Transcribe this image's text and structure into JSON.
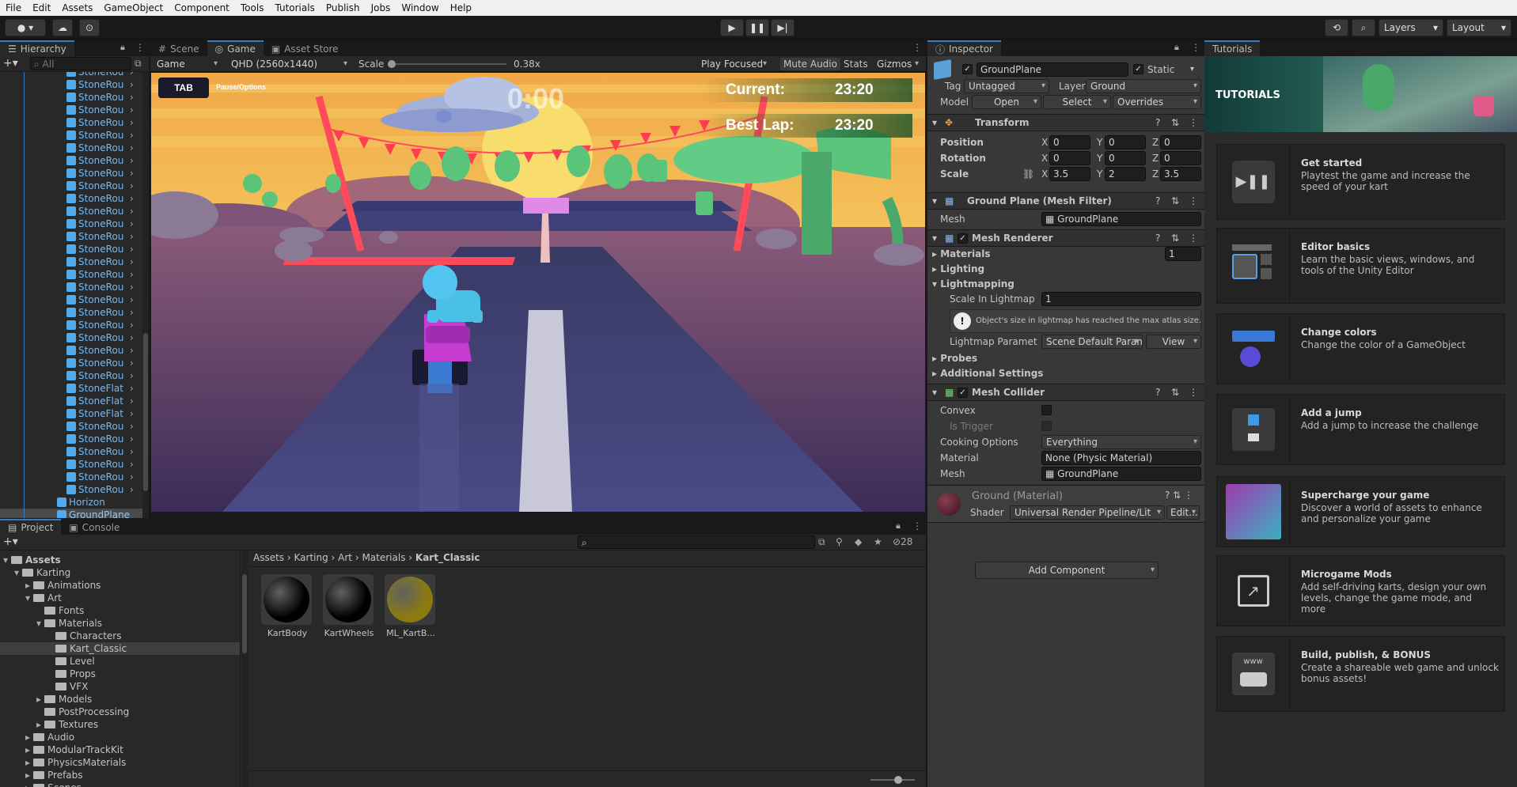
{
  "menu": [
    "File",
    "Edit",
    "Assets",
    "GameObject",
    "Component",
    "Tools",
    "Tutorials",
    "Publish",
    "Jobs",
    "Window",
    "Help"
  ],
  "toolbar": {
    "layers": "Layers",
    "layout": "Layout"
  },
  "hierarchy": {
    "tab": "Hierarchy",
    "search_placeholder": "All",
    "stone_items": [
      "StoneRou",
      "StoneRou",
      "StoneRou",
      "StoneRou",
      "StoneRou",
      "StoneRou",
      "StoneRou",
      "StoneRou",
      "StoneRou",
      "StoneRou",
      "StoneRou",
      "StoneRou",
      "StoneRou",
      "StoneRou",
      "StoneRou",
      "StoneRou",
      "StoneRou",
      "StoneRou",
      "StoneRou",
      "StoneRou",
      "StoneRou",
      "StoneRou",
      "StoneRou",
      "StoneRou",
      "StoneRou",
      "StoneFlat",
      "StoneFlat",
      "StoneFlat",
      "StoneRou",
      "StoneRou",
      "StoneRou",
      "StoneRou",
      "StoneRou",
      "StoneRou"
    ],
    "horizon": "Horizon",
    "groundplane": "GroundPlane"
  },
  "game": {
    "tabs": [
      "Scene",
      "Game",
      "Asset Store"
    ],
    "display": "Game",
    "resolution": "QHD (2560x1440)",
    "scale_label": "Scale",
    "scale_value": "0.38x",
    "play_focused": "Play Focused",
    "mute": "Mute Audio",
    "stats": "Stats",
    "gizmos": "Gizmos",
    "hud_tab": "TAB",
    "hud_pause": "Pause/Options",
    "hud_timer": "0:00",
    "hud_current_label": "Current:",
    "hud_current_value": "23:20",
    "hud_best_label": "Best Lap:",
    "hud_best_value": "23:20"
  },
  "inspector": {
    "tab": "Inspector",
    "object_name": "GroundPlane",
    "static": "Static",
    "tag_label": "Tag",
    "tag": "Untagged",
    "layer_label": "Layer",
    "layer": "Ground",
    "model_label": "Model",
    "open": "Open",
    "select": "Select",
    "overrides": "Overrides",
    "transform": {
      "title": "Transform",
      "position": "Position",
      "rotation": "Rotation",
      "scale": "Scale",
      "pos": [
        "0",
        "0",
        "0"
      ],
      "rot": [
        "0",
        "0",
        "0"
      ],
      "scl": [
        "3.5",
        "2",
        "3.5"
      ],
      "axes": [
        "X",
        "Y",
        "Z"
      ]
    },
    "mesh_filter": {
      "title": "Ground Plane (Mesh Filter)",
      "mesh_label": "Mesh",
      "mesh": "GroundPlane"
    },
    "mesh_renderer": {
      "title": "Mesh Renderer",
      "materials": "Materials",
      "materials_count": "1",
      "lighting": "Lighting",
      "lightmapping": "Lightmapping",
      "scale_in_lightmap": "Scale In Lightmap",
      "scale_value": "1",
      "warning": "Object's size in lightmap has reached the max atlas size.",
      "lightmap_params": "Lightmap Paramet",
      "lightmap_params_value": "Scene Default Paramete",
      "view": "View",
      "probes": "Probes",
      "additional": "Additional Settings"
    },
    "mesh_collider": {
      "title": "Mesh Collider",
      "convex": "Convex",
      "is_trigger": "Is Trigger",
      "cooking": "Cooking Options",
      "cooking_value": "Everything",
      "material": "Material",
      "material_value": "None (Physic Material)",
      "mesh": "Mesh",
      "mesh_value": "GroundPlane"
    },
    "material": {
      "name": "Ground (Material)",
      "shader_label": "Shader",
      "shader": "Universal Render Pipeline/Lit",
      "edit": "Edit..."
    },
    "add_component": "Add Component"
  },
  "tutorials": {
    "tab": "Tutorials",
    "banner": "TUTORIALS",
    "cards": [
      {
        "title": "Get started",
        "desc": "Playtest the game and increase the speed of your kart"
      },
      {
        "title": "Editor basics",
        "desc": "Learn the basic views, windows, and tools of the Unity Editor"
      },
      {
        "title": "Change colors",
        "desc": "Change the color of a GameObject"
      },
      {
        "title": "Add a jump",
        "desc": "Add a jump to increase the challenge"
      },
      {
        "title": "Supercharge your game",
        "desc": "Discover a world of assets to enhance and personalize your game"
      },
      {
        "title": "Microgame Mods",
        "desc": "Add self-driving karts, design your own levels, change the game mode, and more"
      },
      {
        "title": "Build, publish, & BONUS",
        "desc": "Create a shareable web game and unlock bonus assets!"
      }
    ],
    "www": "www"
  },
  "project": {
    "tabs": [
      "Project",
      "Console"
    ],
    "tree": [
      {
        "label": "Assets",
        "indent": 0,
        "bold": true
      },
      {
        "label": "Karting",
        "indent": 1
      },
      {
        "label": "Animations",
        "indent": 2
      },
      {
        "label": "Art",
        "indent": 2
      },
      {
        "label": "Fonts",
        "indent": 3
      },
      {
        "label": "Materials",
        "indent": 3
      },
      {
        "label": "Characters",
        "indent": 4
      },
      {
        "label": "Kart_Classic",
        "indent": 4,
        "selected": true
      },
      {
        "label": "Level",
        "indent": 4
      },
      {
        "label": "Props",
        "indent": 4
      },
      {
        "label": "VFX",
        "indent": 4
      },
      {
        "label": "Models",
        "indent": 3
      },
      {
        "label": "PostProcessing",
        "indent": 3
      },
      {
        "label": "Textures",
        "indent": 3
      },
      {
        "label": "Audio",
        "indent": 2
      },
      {
        "label": "ModularTrackKit",
        "indent": 2
      },
      {
        "label": "PhysicsMaterials",
        "indent": 2
      },
      {
        "label": "Prefabs",
        "indent": 2
      },
      {
        "label": "Scenes",
        "indent": 2
      }
    ],
    "breadcrumb": [
      "Assets",
      "Karting",
      "Art",
      "Materials",
      "Kart_Classic"
    ],
    "hidden_count": "28",
    "assets": [
      {
        "name": "KartBody",
        "color": "#000000"
      },
      {
        "name": "KartWheels",
        "color": "#000000"
      },
      {
        "name": "ML_KartB...",
        "color": "#8a7a10"
      }
    ]
  }
}
